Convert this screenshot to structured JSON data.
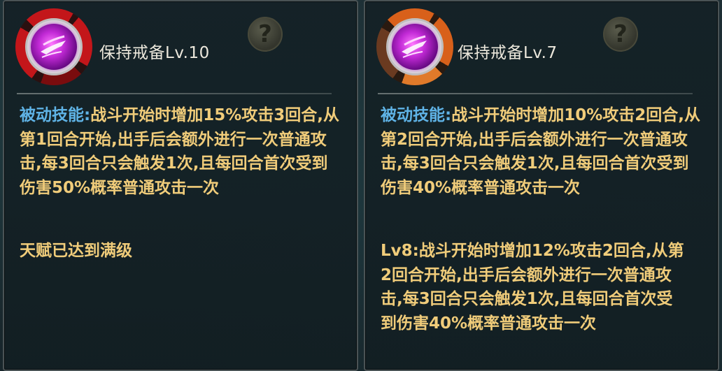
{
  "left_panel": {
    "title": "保持戒备Lv.10",
    "passive_tag": "被动技能:",
    "description": "战斗开始时增加15%攻击3回合,从第1回合开始,出手后会额外进行一次普通攻击,每3回合只会触发1次,且每回合首次受到伤害50%概率普通攻击一次",
    "note": "天赋已达到满级",
    "help_glyph": "?",
    "ring_color": "#c3161a",
    "icon": "dash-skill-icon"
  },
  "right_panel": {
    "title": "保持戒备Lv.7",
    "passive_tag": "被动技能:",
    "description": "战斗开始时增加10%攻击2回合,从第2回合开始,出手后会额外进行一次普通攻击,每3回合只会触发1次,且每回合首次受到伤害40%概率普通攻击一次",
    "note": "Lv8:战斗开始时增加12%攻击2回合,从第2回合开始,出手后会额外进行一次普通攻击,每3回合只会触发1次,且每回合首次受到伤害40%概率普通攻击一次",
    "help_glyph": "?",
    "ring_color": "#d8601a",
    "icon": "dash-skill-icon"
  },
  "colors": {
    "description_text": "#f0cc7a",
    "passive_tag": "#5fb3e6",
    "title_text": "#ece8dc"
  }
}
